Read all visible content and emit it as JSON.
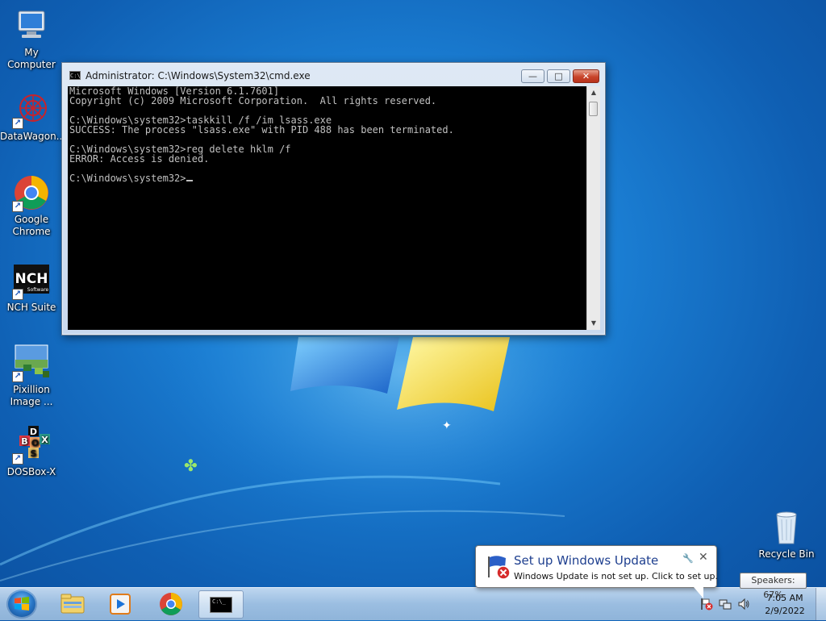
{
  "desktop": {
    "icons": [
      {
        "label": "My Computer",
        "icon": "computer-icon"
      },
      {
        "label": "DataWagon...",
        "icon": "datawagon-icon"
      },
      {
        "label": "Google Chrome",
        "icon": "chrome-icon"
      },
      {
        "label": "NCH Suite",
        "icon": "nch-icon"
      },
      {
        "label": "Pixillion Image ...",
        "icon": "pixillion-icon"
      },
      {
        "label": "DOSBox-X",
        "icon": "dosbox-icon"
      },
      {
        "label": "Recycle Bin",
        "icon": "recycle-bin-icon"
      }
    ],
    "nch_logo_text": "NCH",
    "nch_logo_sub": "Software"
  },
  "cmd_window": {
    "title": "Administrator: C:\\Windows\\System32\\cmd.exe",
    "icon_text": "C:\\",
    "buttons": {
      "minimize": "—",
      "maximize": "□",
      "close": "✕"
    },
    "lines": [
      "Microsoft Windows [Version 6.1.7601]",
      "Copyright (c) 2009 Microsoft Corporation.  All rights reserved.",
      "",
      "C:\\Windows\\system32>taskkill /f /im lsass.exe",
      "SUCCESS: The process \"lsass.exe\" with PID 488 has been terminated.",
      "",
      "C:\\Windows\\system32>reg delete hklm /f",
      "ERROR: Access is denied.",
      ""
    ],
    "prompt": "C:\\Windows\\system32>"
  },
  "balloon": {
    "title": "Set up Windows Update",
    "text": "Windows Update is not set up. Click to set up.",
    "pin_glyph": "🔧",
    "close_glyph": "✕"
  },
  "tooltip": {
    "text": "Speakers: 67%"
  },
  "taskbar": {
    "pinned": [
      "explorer-icon",
      "media-player-icon",
      "chrome-icon",
      "cmd-icon"
    ],
    "clock_time": "7:05 AM",
    "clock_date": "2/9/2022",
    "cmd_icon_text": "C:\\_"
  },
  "colors": {
    "console_bg": "#000000",
    "console_fg": "#c0c0c0",
    "balloon_title": "#1e3f8f"
  }
}
